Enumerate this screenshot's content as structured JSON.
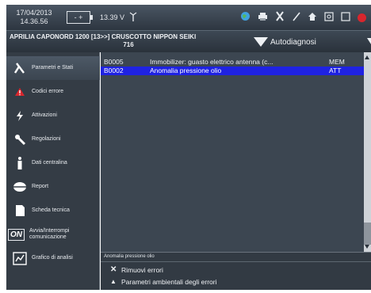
{
  "status": {
    "date": "17/04/2013",
    "time": "14.36.56",
    "battery_glyphs": "- +",
    "voltage": "13.39 V",
    "antenna_icon": "antenna-icon",
    "tools": [
      "globe-icon",
      "print-icon",
      "tools-icon",
      "pen-icon",
      "home-icon",
      "settings-icon",
      "window-icon",
      "stop-icon"
    ]
  },
  "header": {
    "vehicle_line1": "APRILIA CAPONORD 1200 [13>>] CRUSCOTTO NIPPON SEIKI",
    "vehicle_line2": "716",
    "mode_label": "Autodiagnosi"
  },
  "sidebar": {
    "items": [
      {
        "label": "Parametri e Stati",
        "icon": "lambda-icon"
      },
      {
        "label": "Codici errore",
        "icon": "warning-icon"
      },
      {
        "label": "Attivazioni",
        "icon": "lightning-icon"
      },
      {
        "label": "Regolazioni",
        "icon": "wrench-icon"
      },
      {
        "label": "Dati centralina",
        "icon": "info-icon"
      },
      {
        "label": "Report",
        "icon": "report-icon"
      },
      {
        "label": "Scheda tecnica",
        "icon": "document-icon"
      },
      {
        "label": "Avvia/Interrompi comunicazione",
        "icon": "on-icon",
        "badge": "ON"
      },
      {
        "label": "Grafico di analisi",
        "icon": "chart-icon"
      }
    ]
  },
  "errors": {
    "rows": [
      {
        "code": "B0005",
        "description": "Immobilizer: guasto elettrico antenna (c...",
        "state": "MEM"
      },
      {
        "code": "B0002",
        "description": "Anomalia pressione olio",
        "state": "ATT"
      }
    ],
    "selected_index": 1
  },
  "detail": {
    "label": "Anomalia pressione olio",
    "actions": [
      {
        "label": "Rimuovi errori",
        "icon": "close-icon",
        "glyph": "✕"
      },
      {
        "label": "Parametri ambientali degli errori",
        "icon": "warning-icon",
        "glyph": "▲"
      }
    ]
  },
  "colors": {
    "selected_row": "#1f22e2",
    "panel": "#3c4651",
    "sidebar": "#343c45",
    "warning": "#d8262d"
  }
}
